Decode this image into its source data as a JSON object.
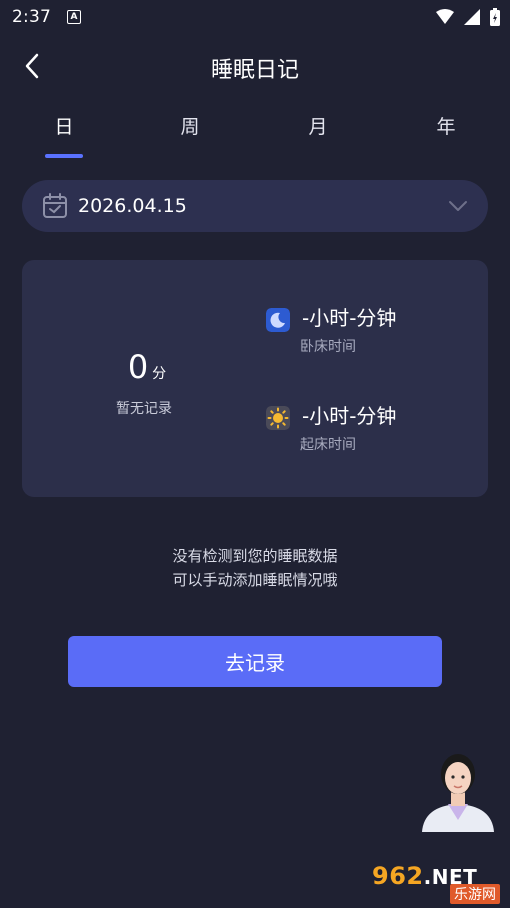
{
  "status_bar": {
    "time": "2:37",
    "notification_glyph": "A"
  },
  "header": {
    "title": "睡眠日记"
  },
  "tabs": [
    {
      "label": "日",
      "active": true
    },
    {
      "label": "周",
      "active": false
    },
    {
      "label": "月",
      "active": false
    },
    {
      "label": "年",
      "active": false
    }
  ],
  "date_picker": {
    "value": "2026.04.15"
  },
  "summary": {
    "score_value": "0",
    "score_unit": "分",
    "score_label": "暂无记录",
    "bedtime": {
      "value": "-小时-分钟",
      "label": "卧床时间",
      "icon": "moon-icon"
    },
    "wakeup": {
      "value": "-小时-分钟",
      "label": "起床时间",
      "icon": "sun-icon"
    }
  },
  "empty_message": {
    "line1": "没有检测到您的睡眠数据",
    "line2": "可以手动添加睡眠情况哦"
  },
  "actions": {
    "record_label": "去记录"
  },
  "watermark": {
    "brand": "962",
    "suffix": ".NET",
    "sub": "乐游网"
  },
  "colors": {
    "background": "#1f2132",
    "card": "#2c2f4a",
    "accent": "#5a6cf7"
  }
}
